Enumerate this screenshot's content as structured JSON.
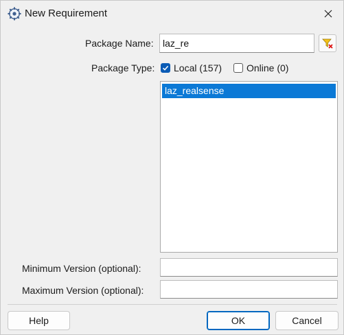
{
  "window": {
    "title": "New Requirement",
    "icon": "gear-app-icon",
    "close_icon": "close-icon"
  },
  "form": {
    "package_name_label": "Package Name:",
    "package_name_value": "laz_re",
    "filter_icon": "filter-clear-icon",
    "package_type_label": "Package Type:",
    "local_label": "Local (157)",
    "local_checked": true,
    "online_label": "Online (0)",
    "online_checked": false,
    "results": [
      "laz_realsense"
    ],
    "min_version_label": "Minimum Version (optional):",
    "min_version_value": "",
    "max_version_label": "Maximum Version (optional):",
    "max_version_value": ""
  },
  "buttons": {
    "help": "Help",
    "ok": "OK",
    "cancel": "Cancel"
  },
  "colors": {
    "accent": "#0b79d6",
    "checkbox": "#0a5bb5",
    "background": "#f0f0f0"
  }
}
